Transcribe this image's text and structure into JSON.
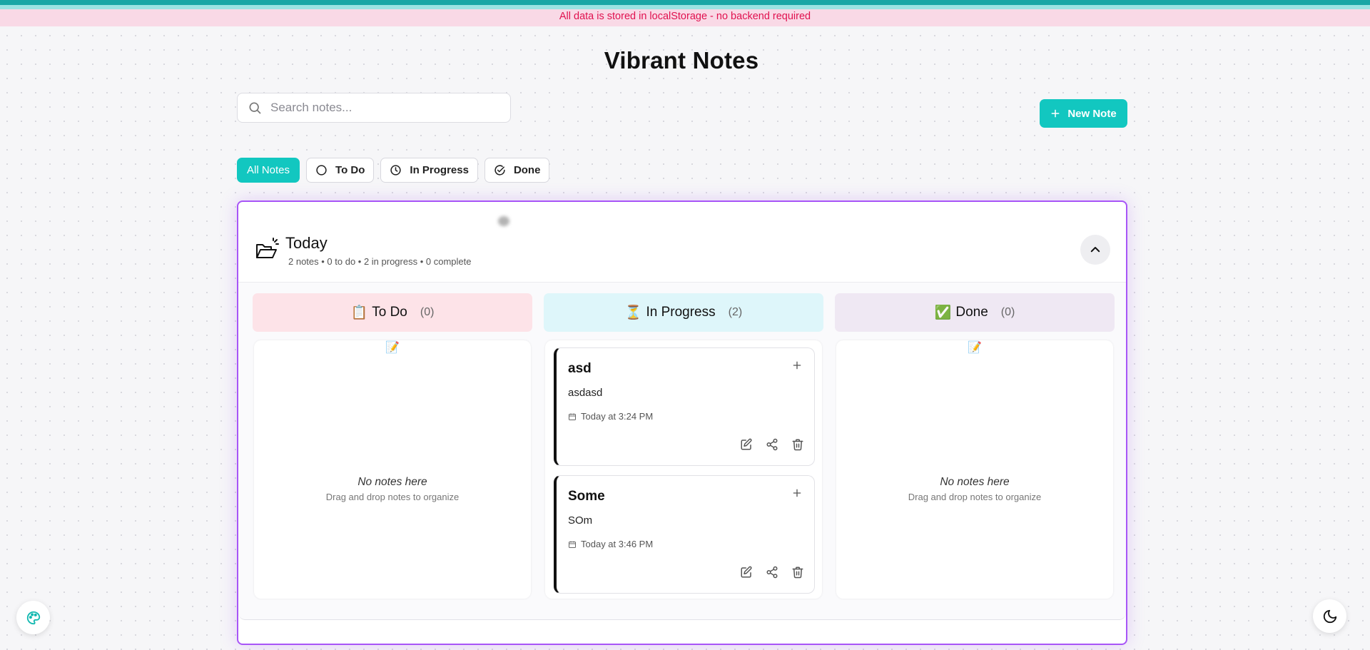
{
  "banner": {
    "text": "All data is stored in localStorage - no backend required"
  },
  "app": {
    "title": "Vibrant Notes"
  },
  "search": {
    "placeholder": "Search notes..."
  },
  "toolbar": {
    "new_note_label": "New Note"
  },
  "filters": [
    {
      "label": "All Notes",
      "active": true
    },
    {
      "label": "To Do",
      "icon": "circle-icon"
    },
    {
      "label": "In Progress",
      "icon": "clock-icon"
    },
    {
      "label": "Done",
      "icon": "check-circle-icon"
    }
  ],
  "group": {
    "title": "Today",
    "summary": "2 notes • 0 to do • 2 in progress • 0 complete",
    "accent": "#a855f7"
  },
  "columns": [
    {
      "emoji": "📋",
      "label": "To Do",
      "count": "(0)",
      "color": "#fde3e8"
    },
    {
      "emoji": "⏳",
      "label": "In Progress",
      "count": "(2)",
      "color": "#def6fa"
    },
    {
      "emoji": "✅",
      "label": "Done",
      "count": "(0)",
      "color": "#efe8f3"
    }
  ],
  "empty_state": {
    "emoji": "📝",
    "title": "No notes here",
    "subtitle": "Drag and drop notes to organize"
  },
  "notes": [
    {
      "title": "asd",
      "body": "asdasd",
      "date": "Today at 3:24 PM"
    },
    {
      "title": "Some",
      "body": "SOm",
      "date": "Today at 3:46 PM"
    }
  ],
  "colors": {
    "accent": "#12c7c0",
    "banner_text": "#e0114f",
    "banner_bg": "#f9d9e6"
  }
}
